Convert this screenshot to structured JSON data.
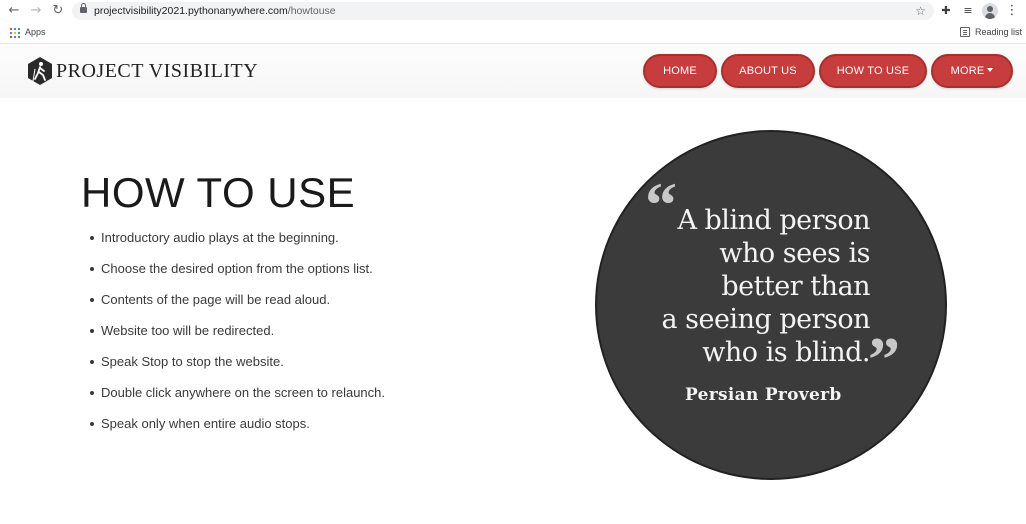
{
  "browser": {
    "url_host": "projectvisibility2021.pythonanywhere.com",
    "url_path": "/howtouse",
    "bookmarks": {
      "apps_label": "Apps",
      "reading_list_label": "Reading list"
    }
  },
  "header": {
    "logo_text": "PROJECT VISIBILITY",
    "nav": [
      {
        "label": "HOME"
      },
      {
        "label": "ABOUT US"
      },
      {
        "label": "HOW TO USE"
      },
      {
        "label": "MORE"
      }
    ],
    "nav_color": "#c73d3d"
  },
  "main": {
    "title": "HOW TO USE",
    "instructions": [
      "Introductory audio plays at the beginning.",
      "Choose the desired option from the options list.",
      "Contents of the page will be read aloud.",
      "Website too will be redirected.",
      "Speak Stop to stop the website.",
      "Double click anywhere on the screen to relaunch.",
      "Speak only when entire audio stops."
    ],
    "quote": {
      "open_mark": "“",
      "close_mark": "”",
      "lines": [
        "A blind person",
        "who sees is",
        "better than",
        "a seeing person",
        "who is blind."
      ],
      "author": "Persian Proverb",
      "background": "#3b3b3b"
    }
  }
}
